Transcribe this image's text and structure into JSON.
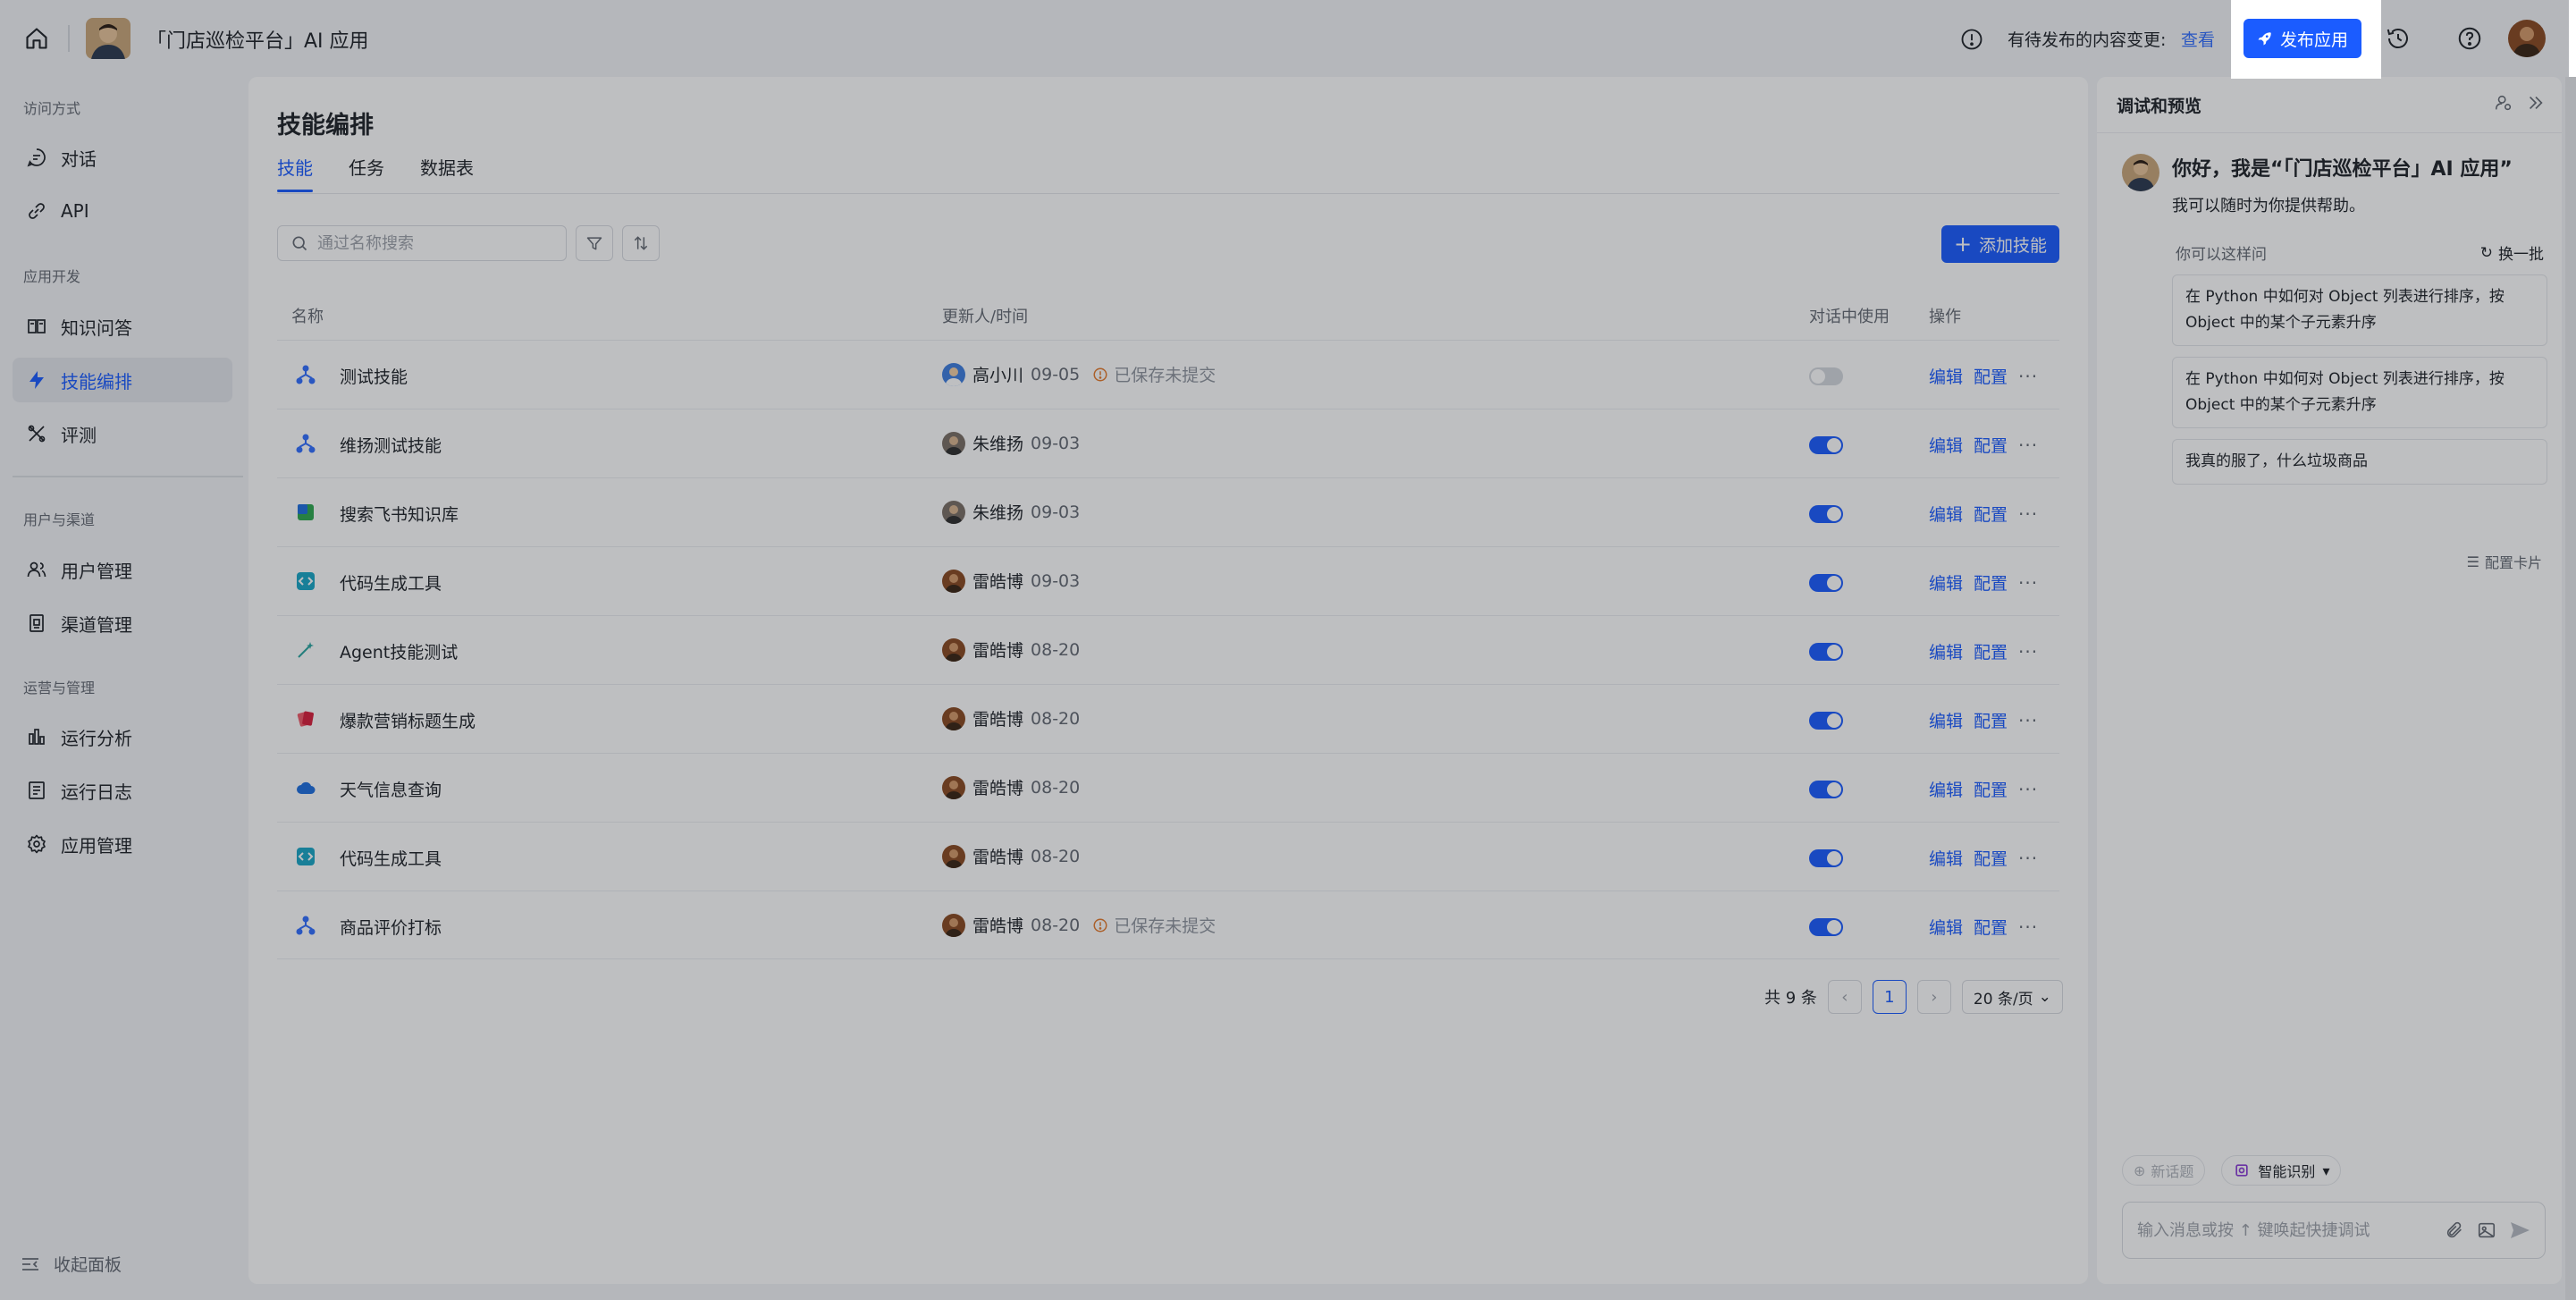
{
  "header": {
    "app_title": "「门店巡检平台」AI 应用",
    "pending_text": "有待发布的内容变更:",
    "pending_link": "查看",
    "publish_label": "发布应用"
  },
  "sidebar": {
    "sections": [
      {
        "title": "访问方式",
        "items": [
          {
            "label": "对话",
            "icon": "chat-bubble-icon"
          },
          {
            "label": "API",
            "icon": "link-icon"
          }
        ]
      },
      {
        "title": "应用开发",
        "items": [
          {
            "label": "知识问答",
            "icon": "book-icon"
          },
          {
            "label": "技能编排",
            "icon": "lightning-icon",
            "active": true
          },
          {
            "label": "评测",
            "icon": "tools-icon"
          }
        ]
      },
      {
        "title": "用户与渠道",
        "items": [
          {
            "label": "用户管理",
            "icon": "users-icon"
          },
          {
            "label": "渠道管理",
            "icon": "channel-icon"
          }
        ]
      },
      {
        "title": "运营与管理",
        "items": [
          {
            "label": "运行分析",
            "icon": "bar-chart-icon"
          },
          {
            "label": "运行日志",
            "icon": "log-icon"
          },
          {
            "label": "应用管理",
            "icon": "gear-icon"
          }
        ]
      }
    ],
    "collapse_label": "收起面板"
  },
  "main": {
    "title": "技能编排",
    "tabs": [
      "技能",
      "任务",
      "数据表"
    ],
    "search_placeholder": "通过名称搜索",
    "add_skill_label": "添加技能",
    "columns": {
      "name": "名称",
      "updater": "更新人/时间",
      "in_chat": "对话中使用",
      "ops": "操作"
    },
    "rows": [
      {
        "name": "测试技能",
        "icon": "workflow-icon",
        "user": "高小川",
        "time": "09-05",
        "warn": "已保存未提交",
        "enabled": false
      },
      {
        "name": "维扬测试技能",
        "icon": "workflow-icon",
        "user": "朱维扬",
        "time": "09-03",
        "warn": "",
        "enabled": true
      },
      {
        "name": "搜索飞书知识库",
        "icon": "knowledge-base-icon",
        "user": "朱维扬",
        "time": "09-03",
        "warn": "",
        "enabled": true
      },
      {
        "name": "代码生成工具",
        "icon": "code-icon",
        "user": "雷皓博",
        "time": "09-03",
        "warn": "",
        "enabled": true
      },
      {
        "name": "Agent技能测试",
        "icon": "magic-wand-icon",
        "user": "雷皓博",
        "time": "08-20",
        "warn": "",
        "enabled": true
      },
      {
        "name": "爆款营销标题生成",
        "icon": "cards-icon",
        "user": "雷皓博",
        "time": "08-20",
        "warn": "",
        "enabled": true
      },
      {
        "name": "天气信息查询",
        "icon": "cloud-icon",
        "user": "雷皓博",
        "time": "08-20",
        "warn": "",
        "enabled": true
      },
      {
        "name": "代码生成工具",
        "icon": "code-icon",
        "user": "雷皓博",
        "time": "08-20",
        "warn": "",
        "enabled": true
      },
      {
        "name": "商品评价打标",
        "icon": "workflow-icon",
        "user": "雷皓博",
        "time": "08-20",
        "warn": "已保存未提交",
        "enabled": true
      }
    ],
    "op_edit": "编辑",
    "op_config": "配置",
    "op_more": "···",
    "pagination": {
      "total": "共 9 条",
      "page": "1",
      "page_size": "20 条/页"
    }
  },
  "debug": {
    "title": "调试和预览",
    "greeting": "你好，我是“「门店巡检平台」AI 应用”",
    "greeting_sub": "我可以随时为你提供帮助。",
    "ask_label": "你可以这样问",
    "refresh_label": "换一批",
    "suggestions": [
      "在 Python 中如何对 Object 列表进行排序，按 Object 中的某个子元素升序",
      "在 Python 中如何对 Object 列表进行排序，按 Object 中的某个子元素升序",
      "我真的服了，什么垃圾商品"
    ],
    "config_card": "配置卡片",
    "new_topic": "新话题",
    "smart_id": "智能识别",
    "input_placeholder": "输入消息或按 ↑ 键唤起快捷调试"
  },
  "colors": {
    "accent": "#1b5cff",
    "link": "#3370ff",
    "warn": "#e57c2e"
  }
}
